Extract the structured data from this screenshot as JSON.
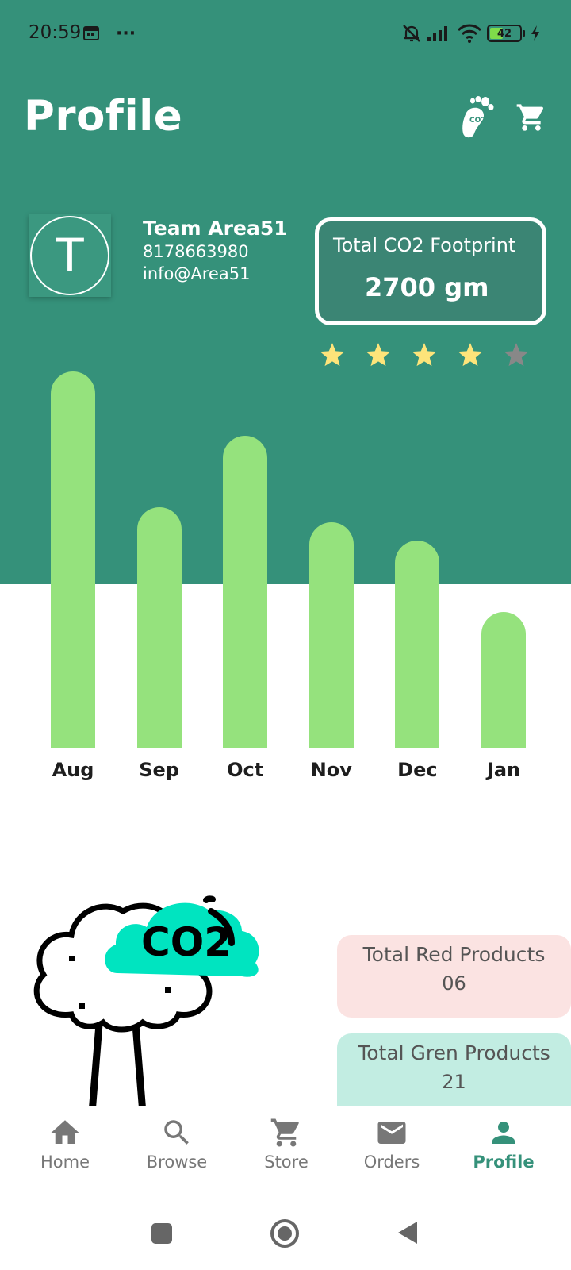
{
  "status_bar": {
    "time": "20:59",
    "more": "···",
    "battery": "42",
    "icons": [
      "calendar-icon",
      "bell-off-icon",
      "signal-icon",
      "wifi-icon",
      "battery-icon",
      "charging-icon"
    ]
  },
  "header": {
    "title": "Profile",
    "icons": [
      "co2-footprint-icon",
      "cart-icon"
    ]
  },
  "profile": {
    "avatar_letter": "T",
    "name": "Team Area51",
    "phone": "8178663980",
    "email": "info@Area51"
  },
  "co2_card": {
    "label": "Total CO2 Footprint",
    "value": "2700 gm"
  },
  "rating": {
    "value": 4,
    "max": 5,
    "filled_color": "#fde47a",
    "empty_color": "#888888"
  },
  "chart_data": {
    "type": "bar",
    "categories": [
      "Aug",
      "Sep",
      "Oct",
      "Nov",
      "Dec",
      "Jan"
    ],
    "values": [
      100,
      64,
      83,
      60,
      55,
      36
    ],
    "color": "#95e27d"
  },
  "summary": {
    "red_products_label": "Total Red Products",
    "red_products_value": "06",
    "green_products_label": "Total Gren Products",
    "green_products_value": "21"
  },
  "illustration": {
    "badge_text": "CO2"
  },
  "bottom_nav": {
    "items": [
      {
        "label": "Home",
        "icon": "home-icon"
      },
      {
        "label": "Browse",
        "icon": "search-icon"
      },
      {
        "label": "Store",
        "icon": "cart-icon"
      },
      {
        "label": "Orders",
        "icon": "mail-icon"
      },
      {
        "label": "Profile",
        "icon": "person-icon"
      }
    ],
    "active": "Profile"
  },
  "colors": {
    "primary": "#35917a",
    "bar": "#95e27d",
    "red_card": "#fbe3e2",
    "green_card": "#c2ede2"
  }
}
